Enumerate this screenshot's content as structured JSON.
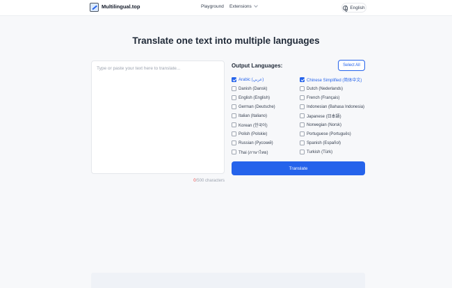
{
  "header": {
    "brand": "Multilingual.top",
    "logo_icon": "translate-logo-icon",
    "nav": [
      {
        "label": "Playground"
      },
      {
        "label": "Extensions"
      }
    ],
    "language_selector": "English"
  },
  "main": {
    "title": "Translate one text into multiple languages",
    "input": {
      "placeholder": "Type or paste your text here to translate...",
      "value": ""
    },
    "counter": {
      "current": "0",
      "suffix": "/500 characters"
    },
    "output": {
      "label": "Output Languages:",
      "select_all": "Select All",
      "languages": [
        {
          "label": "Arabic (عربي)",
          "checked": true
        },
        {
          "label": "Chinese Simplified (简体中文)",
          "checked": true
        },
        {
          "label": "Danish (Dansk)",
          "checked": false
        },
        {
          "label": "Dutch (Nederlands)",
          "checked": false
        },
        {
          "label": "English (English)",
          "checked": false
        },
        {
          "label": "French (Français)",
          "checked": false
        },
        {
          "label": "German (Deutsche)",
          "checked": false
        },
        {
          "label": "Indonesian (Bahasa Indonesia)",
          "checked": false
        },
        {
          "label": "Italian (Italiano)",
          "checked": false
        },
        {
          "label": "Japanese (日本語)",
          "checked": false
        },
        {
          "label": "Korean (한국어)",
          "checked": false
        },
        {
          "label": "Norwegian (Norsk)",
          "checked": false
        },
        {
          "label": "Polish (Polskie)",
          "checked": false
        },
        {
          "label": "Portuguese (Português)",
          "checked": false
        },
        {
          "label": "Russian (Русский)",
          "checked": false
        },
        {
          "label": "Spanish (Español)",
          "checked": false
        },
        {
          "label": "Thai (ภาษาไทย)",
          "checked": false
        },
        {
          "label": "Turkish (Türk)",
          "checked": false
        }
      ],
      "translate": "Translate"
    }
  },
  "colors": {
    "accent": "#2563eb",
    "counter_highlight": "#ef4444"
  }
}
